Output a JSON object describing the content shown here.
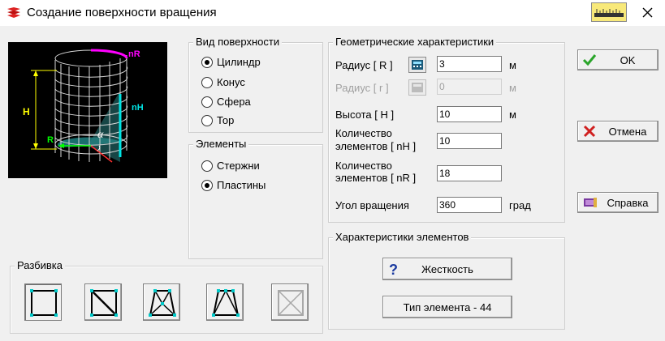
{
  "window": {
    "title": "Создание поверхности вращения"
  },
  "preview": {
    "labels": {
      "nr": "nR",
      "nh": "nH",
      "h": "H",
      "r": "R",
      "alpha": "α"
    }
  },
  "surface_type": {
    "title": "Вид поверхности",
    "options": [
      {
        "label": "Цилиндр",
        "selected": true
      },
      {
        "label": "Конус",
        "selected": false
      },
      {
        "label": "Сфера",
        "selected": false
      },
      {
        "label": "Тор",
        "selected": false
      }
    ]
  },
  "elements": {
    "title": "Элементы",
    "options": [
      {
        "label": "Стержни",
        "selected": false
      },
      {
        "label": "Пластины",
        "selected": true
      }
    ]
  },
  "geometry": {
    "title": "Геометрические характеристики",
    "radius_R": {
      "label": "Радиус [ R ]",
      "value": "3",
      "unit": "м"
    },
    "radius_r": {
      "label": "Радиус [ r ]",
      "value": "0",
      "unit": "м",
      "disabled": true
    },
    "height": {
      "label": "Высота [ H ]",
      "value": "10",
      "unit": "м"
    },
    "count_nH": {
      "label_line1": "Количество",
      "label_line2": "элементов [ nH ]",
      "value": "10"
    },
    "count_nR": {
      "label_line1": "Количество",
      "label_line2": "элементов [ nR ]",
      "value": "18"
    },
    "angle": {
      "label": "Угол вращения",
      "value": "360",
      "unit": "град"
    }
  },
  "element_props": {
    "title": "Характеристики элементов",
    "stiffness_label": "Жесткость",
    "element_type_label": "Тип элемента - 44"
  },
  "mesh": {
    "title": "Разбивка"
  },
  "buttons": {
    "ok": "OK",
    "cancel": "Отмена",
    "help": "Справка"
  },
  "colors": {
    "accent_magenta": "#ff00ff",
    "accent_cyan": "#00e5e5",
    "accent_yellow": "#ffff00",
    "ok_green": "#2aa52a",
    "cancel_red": "#d02020"
  }
}
